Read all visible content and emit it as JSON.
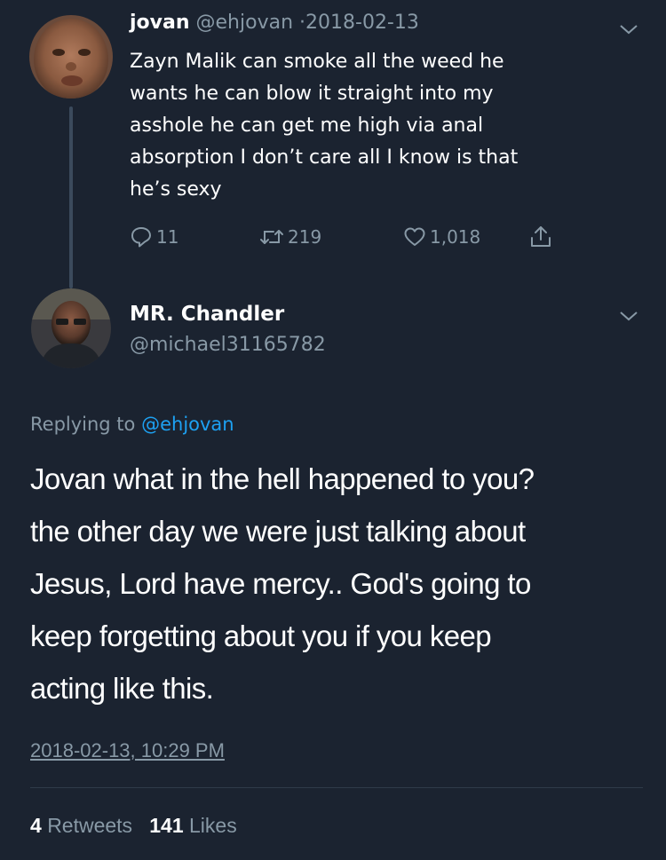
{
  "tweet1": {
    "name": "jovan",
    "handle": "@ehjovan",
    "separator": "·",
    "date": "2018-02-13",
    "text_lines": [
      "Zayn Malik can smoke all the weed he",
      "wants he can blow it straight into my",
      "asshole he can get me high via anal",
      "absorption I don’t care all I know is that",
      "he’s sexy"
    ],
    "actions": {
      "replies": "11",
      "retweets": "219",
      "likes": "1,018"
    },
    "icons": [
      "reply-icon",
      "retweet-icon",
      "like-icon",
      "share-icon",
      "chevron-down-icon"
    ]
  },
  "tweet2": {
    "name": "MR. Chandler",
    "handle": "@michael31165782",
    "replying_prefix": "Replying to",
    "replying_to": "@ehjovan",
    "text_lines": [
      "Jovan what in the hell happened to you?",
      "the other day we were just talking about",
      "Jesus, Lord have mercy.. God's going to",
      "keep forgetting about you if you keep",
      "acting like this."
    ],
    "timestamp": "2018-02-13, 10:29 PM",
    "stats": {
      "retweets_count": "4",
      "retweets_label": "Retweets",
      "likes_count": "141",
      "likes_label": "Likes"
    }
  },
  "colors": {
    "background": "#1b2330",
    "text": "#ffffff",
    "muted": "#8899a6",
    "link": "#1da1f2",
    "thread_line": "#3b4a5c"
  }
}
